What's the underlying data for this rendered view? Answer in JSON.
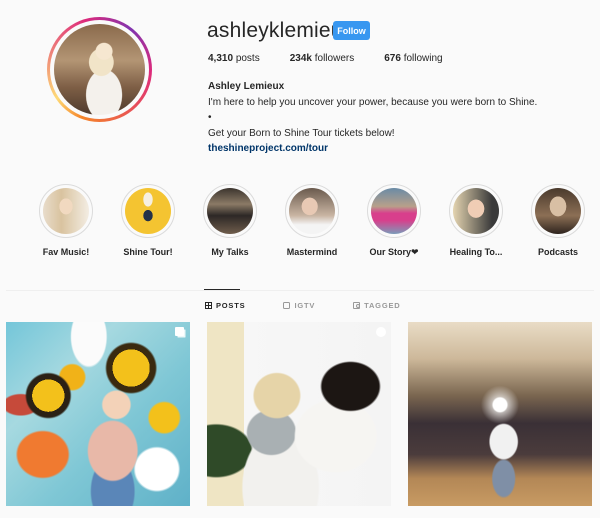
{
  "profile": {
    "username": "ashleyklemieux",
    "follow_label": "Follow",
    "stats": [
      {
        "value": "4,310",
        "label": "posts"
      },
      {
        "value": "234k",
        "label": "followers"
      },
      {
        "value": "676",
        "label": "following"
      }
    ],
    "full_name": "Ashley Lemieux",
    "bio_lines": [
      "I'm here to help you uncover your power, because you were born to Shine.",
      "•",
      "Get your Born to Shine Tour tickets below!"
    ],
    "link": "theshineproject.com/tour"
  },
  "highlights": [
    {
      "label": "Fav Music!"
    },
    {
      "label": "Shine Tour!"
    },
    {
      "label": "My Talks"
    },
    {
      "label": "Mastermind"
    },
    {
      "label": "Our Story❤"
    },
    {
      "label": "Healing To..."
    },
    {
      "label": "Podcasts"
    }
  ],
  "tabs": [
    {
      "label": "POSTS",
      "icon": "grid-icon",
      "active": true
    },
    {
      "label": "IGTV",
      "icon": "igtv-icon",
      "active": false
    },
    {
      "label": "TAGGED",
      "icon": "tagged-icon",
      "active": false
    }
  ],
  "posts": [
    {
      "description": "Woman holding Born to Shine book in front of sunflower mural",
      "badge": "multiple-photos-icon"
    },
    {
      "description": "Woman kneeling holding hands with young girl",
      "badge": "igtv-icon"
    },
    {
      "description": "Woman holding book in front of audience in event hall",
      "badge": ""
    }
  ],
  "colors": {
    "follow_button": "#3897f0",
    "link": "#003569",
    "background": "#fafafa"
  }
}
